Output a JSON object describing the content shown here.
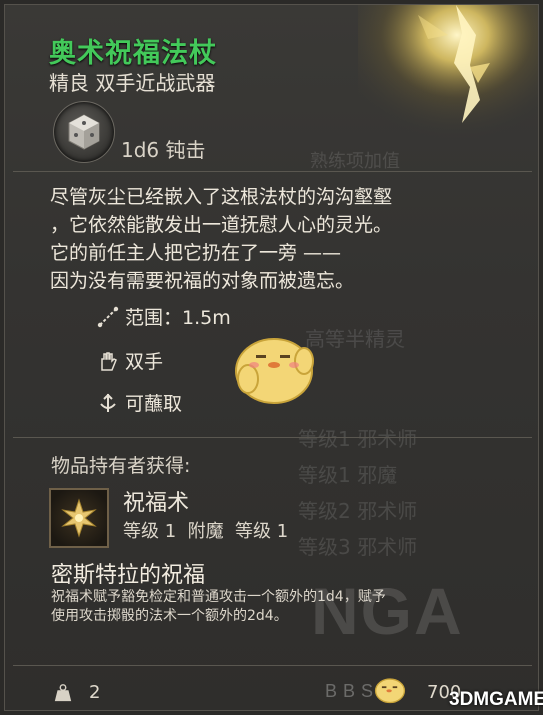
{
  "item": {
    "name": "奥术祝福法杖",
    "type": "精良 双手近战武器",
    "damage": "1d6 钝击",
    "description": [
      "尽管灰尘已经嵌入了这根法杖的沟沟壑壑",
      "，它依然能散发出一道抚慰人心的灵光。",
      "它的前任主人把它扔在了一旁 ——",
      "因为没有需要祝福的对象而被遗忘。"
    ],
    "properties": [
      {
        "icon": "range-icon",
        "label": "范围：1.5m"
      },
      {
        "icon": "two-handed-icon",
        "label": "双手"
      },
      {
        "icon": "dippable-icon",
        "label": "可蘸取"
      }
    ]
  },
  "grants": {
    "header": "物品持有者获得:",
    "spell": {
      "icon": "bless-icon",
      "name": "祝福术",
      "meta": "等级 1  附魔  等级 1"
    },
    "boon": {
      "title": "密斯特拉的祝福",
      "text": [
        "祝福术赋予豁免检定和普通攻击一个额外的1d4，赋予",
        "使用攻击掷骰的法术一个额外的2d4。"
      ]
    }
  },
  "footer": {
    "weight_icon": "weight-icon",
    "weight": "2",
    "value": "700"
  },
  "background_text": [
    "熟练项加值",
    "高等半精灵",
    "等级1 邪术师",
    "等级1 邪魔",
    "等级2 邪术师",
    "等级3 邪术师"
  ],
  "watermarks": {
    "nga": "NGA",
    "bbs": "BBS",
    "site": "3DMGAME"
  },
  "colors": {
    "title_green": "#43c95a",
    "panel": "#353432",
    "text": "#ede7db"
  }
}
